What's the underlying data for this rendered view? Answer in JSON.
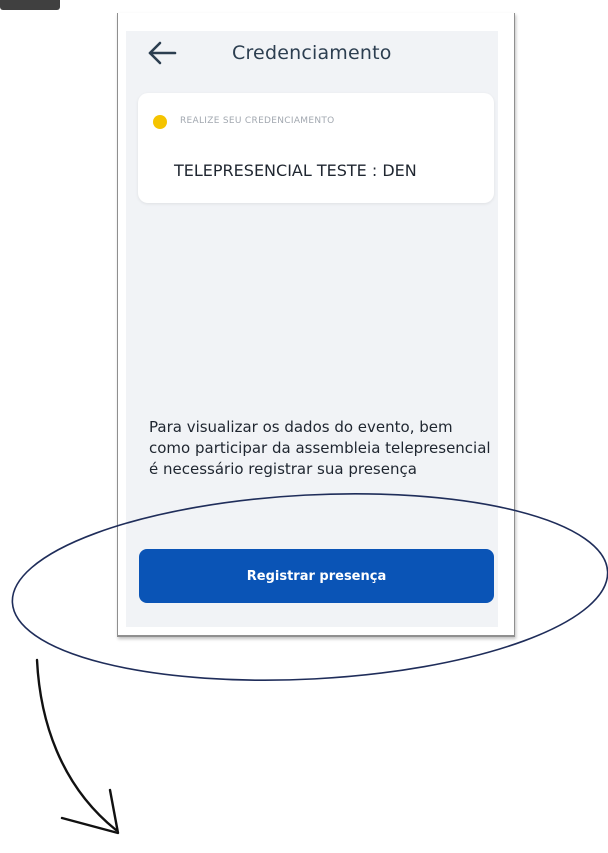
{
  "header": {
    "title": "Credenciamento",
    "back_icon": "arrow-left-icon"
  },
  "card": {
    "status_label": "REALIZE SEU CREDENCIAMENTO",
    "status_color": "#f5c400",
    "event_name": "TELEPRESENCIAL TESTE : DEN"
  },
  "info": {
    "text": "Para visualizar os dados do evento, bem como participar da assembleia telepresencial é necessário registrar sua presença"
  },
  "actions": {
    "register_label": "Registrar presença",
    "register_color": "#0a54b6"
  },
  "annotations": {
    "highlight_shape": "ellipse",
    "pointer_shape": "hand-drawn-arrow",
    "ink_color": "#1f2d5a"
  }
}
